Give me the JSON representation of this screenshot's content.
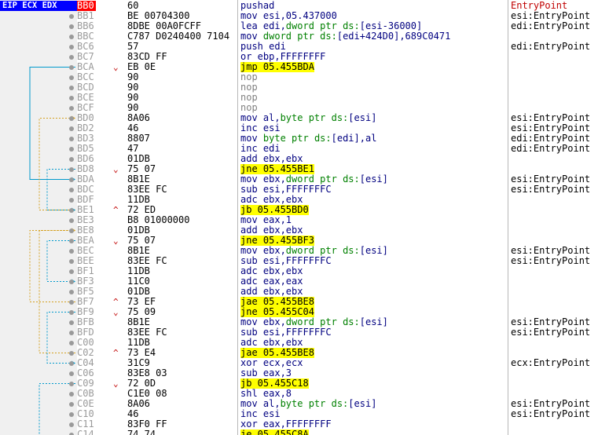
{
  "panel": {
    "register_tag": "EIP ECX EDX"
  },
  "rows": [
    {
      "addr": "BB0",
      "bytes": "60",
      "instr": "pushad",
      "comment": "EntryPoint",
      "type": "plain",
      "current": true,
      "comment_style": "ep"
    },
    {
      "addr": "BB1",
      "bytes": "BE 00704300",
      "instr": "mov esi,05.437000",
      "comment": "esi:EntryPoint",
      "type": "plain"
    },
    {
      "addr": "BB6",
      "bytes": "8DBE 00A0FCFF",
      "instr": "lea edi,dword ptr ds:[esi-36000]",
      "comment": "edi:EntryPoint",
      "type": "plain"
    },
    {
      "addr": "BBC",
      "bytes": "C787 D0240400 7104",
      "instr": "mov dword ptr ds:[edi+424D0],689C0471",
      "comment": "",
      "type": "plain"
    },
    {
      "addr": "BC6",
      "bytes": "57",
      "instr": "push edi",
      "comment": "edi:EntryPoint",
      "type": "plain"
    },
    {
      "addr": "BC7",
      "bytes": "83CD FF",
      "instr": "or ebp,FFFFFFFF",
      "comment": "",
      "type": "plain"
    },
    {
      "addr": "BCA",
      "bytes": "EB 0E",
      "instr": "jmp 05.455BDA",
      "comment": "",
      "type": "jmp",
      "mark": "down"
    },
    {
      "addr": "BCC",
      "bytes": "90",
      "instr": "nop",
      "comment": "",
      "type": "nop"
    },
    {
      "addr": "BCD",
      "bytes": "90",
      "instr": "nop",
      "comment": "",
      "type": "nop"
    },
    {
      "addr": "BCE",
      "bytes": "90",
      "instr": "nop",
      "comment": "",
      "type": "nop"
    },
    {
      "addr": "BCF",
      "bytes": "90",
      "instr": "nop",
      "comment": "",
      "type": "nop"
    },
    {
      "addr": "BD0",
      "bytes": "8A06",
      "instr": "mov al,byte ptr ds:[esi]",
      "comment": "esi:EntryPoint",
      "type": "plain"
    },
    {
      "addr": "BD2",
      "bytes": "46",
      "instr": "inc esi",
      "comment": "esi:EntryPoint",
      "type": "plain"
    },
    {
      "addr": "BD3",
      "bytes": "8807",
      "instr": "mov byte ptr ds:[edi],al",
      "comment": "edi:EntryPoint",
      "type": "plain"
    },
    {
      "addr": "BD5",
      "bytes": "47",
      "instr": "inc edi",
      "comment": "edi:EntryPoint",
      "type": "plain"
    },
    {
      "addr": "BD6",
      "bytes": "01DB",
      "instr": "add ebx,ebx",
      "comment": "",
      "type": "plain"
    },
    {
      "addr": "BD8",
      "bytes": "75 07",
      "instr": "jne 05.455BE1",
      "comment": "",
      "type": "jmp",
      "mark": "down"
    },
    {
      "addr": "BDA",
      "bytes": "8B1E",
      "instr": "mov ebx,dword ptr ds:[esi]",
      "comment": "esi:EntryPoint",
      "type": "plain"
    },
    {
      "addr": "BDC",
      "bytes": "83EE FC",
      "instr": "sub esi,FFFFFFFC",
      "comment": "esi:EntryPoint",
      "type": "plain"
    },
    {
      "addr": "BDF",
      "bytes": "11DB",
      "instr": "adc ebx,ebx",
      "comment": "",
      "type": "plain"
    },
    {
      "addr": "BE1",
      "bytes": "72 ED",
      "instr": "jb 05.455BD0",
      "comment": "",
      "type": "jmp",
      "mark": "up"
    },
    {
      "addr": "BE3",
      "bytes": "B8 01000000",
      "instr": "mov eax,1",
      "comment": "",
      "type": "plain"
    },
    {
      "addr": "BE8",
      "bytes": "01DB",
      "instr": "add ebx,ebx",
      "comment": "",
      "type": "plain"
    },
    {
      "addr": "BEA",
      "bytes": "75 07",
      "instr": "jne 05.455BF3",
      "comment": "",
      "type": "jmp",
      "mark": "down"
    },
    {
      "addr": "BEC",
      "bytes": "8B1E",
      "instr": "mov ebx,dword ptr ds:[esi]",
      "comment": "esi:EntryPoint",
      "type": "plain"
    },
    {
      "addr": "BEE",
      "bytes": "83EE FC",
      "instr": "sub esi,FFFFFFFC",
      "comment": "esi:EntryPoint",
      "type": "plain"
    },
    {
      "addr": "BF1",
      "bytes": "11DB",
      "instr": "adc ebx,ebx",
      "comment": "",
      "type": "plain"
    },
    {
      "addr": "BF3",
      "bytes": "11C0",
      "instr": "adc eax,eax",
      "comment": "",
      "type": "plain"
    },
    {
      "addr": "BF5",
      "bytes": "01DB",
      "instr": "add ebx,ebx",
      "comment": "",
      "type": "plain"
    },
    {
      "addr": "BF7",
      "bytes": "73 EF",
      "instr": "jae 05.455BE8",
      "comment": "",
      "type": "jmp",
      "mark": "up"
    },
    {
      "addr": "BF9",
      "bytes": "75 09",
      "instr": "jne 05.455C04",
      "comment": "",
      "type": "jmp",
      "mark": "down"
    },
    {
      "addr": "BFB",
      "bytes": "8B1E",
      "instr": "mov ebx,dword ptr ds:[esi]",
      "comment": "esi:EntryPoint",
      "type": "plain"
    },
    {
      "addr": "BFD",
      "bytes": "83EE FC",
      "instr": "sub esi,FFFFFFFC",
      "comment": "esi:EntryPoint",
      "type": "plain"
    },
    {
      "addr": "C00",
      "bytes": "11DB",
      "instr": "adc ebx,ebx",
      "comment": "",
      "type": "plain"
    },
    {
      "addr": "C02",
      "bytes": "73 E4",
      "instr": "jae 05.455BE8",
      "comment": "",
      "type": "jmp",
      "mark": "up"
    },
    {
      "addr": "C04",
      "bytes": "31C9",
      "instr": "xor ecx,ecx",
      "comment": "ecx:EntryPoint",
      "type": "plain"
    },
    {
      "addr": "C06",
      "bytes": "83E8 03",
      "instr": "sub eax,3",
      "comment": "",
      "type": "plain"
    },
    {
      "addr": "C09",
      "bytes": "72 0D",
      "instr": "jb 05.455C18",
      "comment": "",
      "type": "jmp",
      "mark": "down"
    },
    {
      "addr": "C0B",
      "bytes": "C1E0 08",
      "instr": "shl eax,8",
      "comment": "",
      "type": "plain"
    },
    {
      "addr": "C0E",
      "bytes": "8A06",
      "instr": "mov al,byte ptr ds:[esi]",
      "comment": "esi:EntryPoint",
      "type": "plain"
    },
    {
      "addr": "C10",
      "bytes": "46",
      "instr": "inc esi",
      "comment": "esi:EntryPoint",
      "type": "plain"
    },
    {
      "addr": "C11",
      "bytes": "83F0 FF",
      "instr": "xor eax,FFFFFFFF",
      "comment": "",
      "type": "plain"
    },
    {
      "addr": "C14",
      "bytes": "74 74",
      "instr": "je 05.455C8A",
      "comment": "",
      "type": "jmp",
      "mark": "down"
    }
  ],
  "marks": {
    "down": "⌄",
    "up": "^"
  },
  "colors": {
    "jump_highlight": "#ffff00",
    "current_eip": "#ff0000",
    "register_bar": "#0000ff",
    "arrow_taken": "#0099cc",
    "arrow_not_taken": "#d4a020"
  },
  "arrows": [
    {
      "from": "BCA",
      "to": "BDA",
      "style": "solid"
    },
    {
      "from": "BE1",
      "to": "BD0",
      "style": "dashed"
    },
    {
      "from": "BD8",
      "to": "BE1",
      "style": "dashed"
    },
    {
      "from": "BF7",
      "to": "BE8",
      "style": "dashed"
    },
    {
      "from": "BEA",
      "to": "BF3",
      "style": "dashed"
    },
    {
      "from": "C02",
      "to": "BE8",
      "style": "dashed"
    },
    {
      "from": "BF9",
      "to": "C04",
      "style": "dashed"
    },
    {
      "from": "C09",
      "to": "C18",
      "style": "dashed"
    }
  ]
}
